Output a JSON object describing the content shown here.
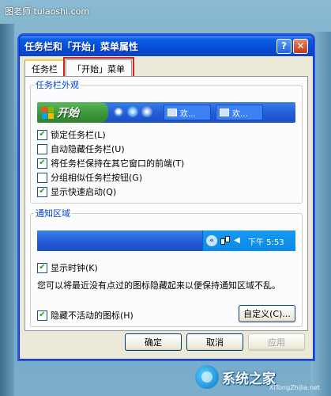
{
  "site_watermark": "图老师 tulaoshi.com",
  "window": {
    "title": "任务栏和「开始」菜单属性"
  },
  "tabs": [
    {
      "label": "任务栏",
      "active": true
    },
    {
      "label": "「开始」菜单",
      "active": false,
      "highlighted": true
    }
  ],
  "appearance": {
    "legend": "任务栏外观",
    "start_label": "开始",
    "task_buttons": [
      "欢...",
      "欢..."
    ],
    "options": [
      {
        "label": "锁定任务栏(L)",
        "checked": true
      },
      {
        "label": "自动隐藏任务栏(U)",
        "checked": false
      },
      {
        "label": "将任务栏保持在其它窗口的前端(T)",
        "checked": true
      },
      {
        "label": "分组相似任务栏按钮(G)",
        "checked": false
      },
      {
        "label": "显示快速启动(Q)",
        "checked": true
      }
    ]
  },
  "notify": {
    "legend": "通知区域",
    "clock": "下午 5:53",
    "show_clock": {
      "label": "显示时钟(K)",
      "checked": true
    },
    "description": "您可以将最近没有点过的图标隐藏起来以便保持通知区域不乱。",
    "hide_inactive": {
      "label": "隐藏不活动的图标(H)",
      "checked": true
    },
    "customize_label": "自定义(C)..."
  },
  "footer": {
    "ok": "确定",
    "cancel": "取消",
    "apply": "应用"
  },
  "brand": {
    "name": "系统之家",
    "url": "XiTongZhiJia.net"
  },
  "colors": {
    "accent": "#0046d5",
    "title_bar": "#0548d4",
    "highlight_border": "#d62020"
  }
}
